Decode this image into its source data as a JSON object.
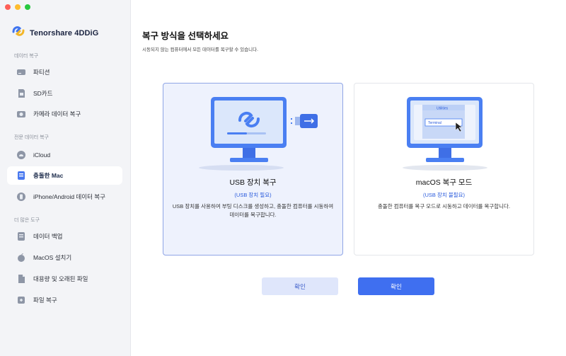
{
  "app": {
    "name": "Tenorshare 4DDiG"
  },
  "sidebar": {
    "sections": [
      {
        "label": "데이터 복구"
      },
      {
        "label": "전문 데이터 복구"
      },
      {
        "label": "더 많은 도구"
      }
    ],
    "items": [
      {
        "label": "파티션",
        "icon": "drive-icon"
      },
      {
        "label": "SD카드",
        "icon": "sd-card-icon"
      },
      {
        "label": "카메라 데이터 복구",
        "icon": "camera-icon"
      },
      {
        "label": "iCloud",
        "icon": "cloud-icon"
      },
      {
        "label": "충돌한 Mac",
        "icon": "crashed-mac-icon",
        "active": true
      },
      {
        "label": "iPhone/Android 데이터 복구",
        "icon": "phone-icon"
      },
      {
        "label": "데이터 백업",
        "icon": "backup-icon"
      },
      {
        "label": "MacOS 설치기",
        "icon": "macos-installer-icon"
      },
      {
        "label": "대용량 및 오래된 파일",
        "icon": "large-file-icon"
      },
      {
        "label": "파일 복구",
        "icon": "file-repair-icon"
      }
    ]
  },
  "main": {
    "title": "복구 방식을 선택하세요",
    "subtitle": "시동되지 않는 컴퓨터에서 모든 데이터를 복구할 수 있습니다.",
    "cards": [
      {
        "title": "USB 장치 복구",
        "requirement": "(USB 장치 필요)",
        "description": "USB 장치를 사용하여 부팅 디스크를 생성하고, 충돌한 컴퓨터를 시동하여 데이터를 복구합니다.",
        "selected": true
      },
      {
        "title": "macOS 복구 모드",
        "requirement": "(USB 장치 불필요)",
        "description": "충돌한 컴퓨터를 복구 모드로 시동하고 데이터를 복구합니다.",
        "art_labels": {
          "menu": "Utilities",
          "item": "Terminal"
        },
        "selected": false
      }
    ],
    "buttons": {
      "left_confirm": "확인",
      "right_confirm": "확인"
    }
  },
  "colors": {
    "accent": "#3f6ff0",
    "selected_bg": "#eef2fd",
    "sidebar_bg": "#f3f4f7"
  }
}
